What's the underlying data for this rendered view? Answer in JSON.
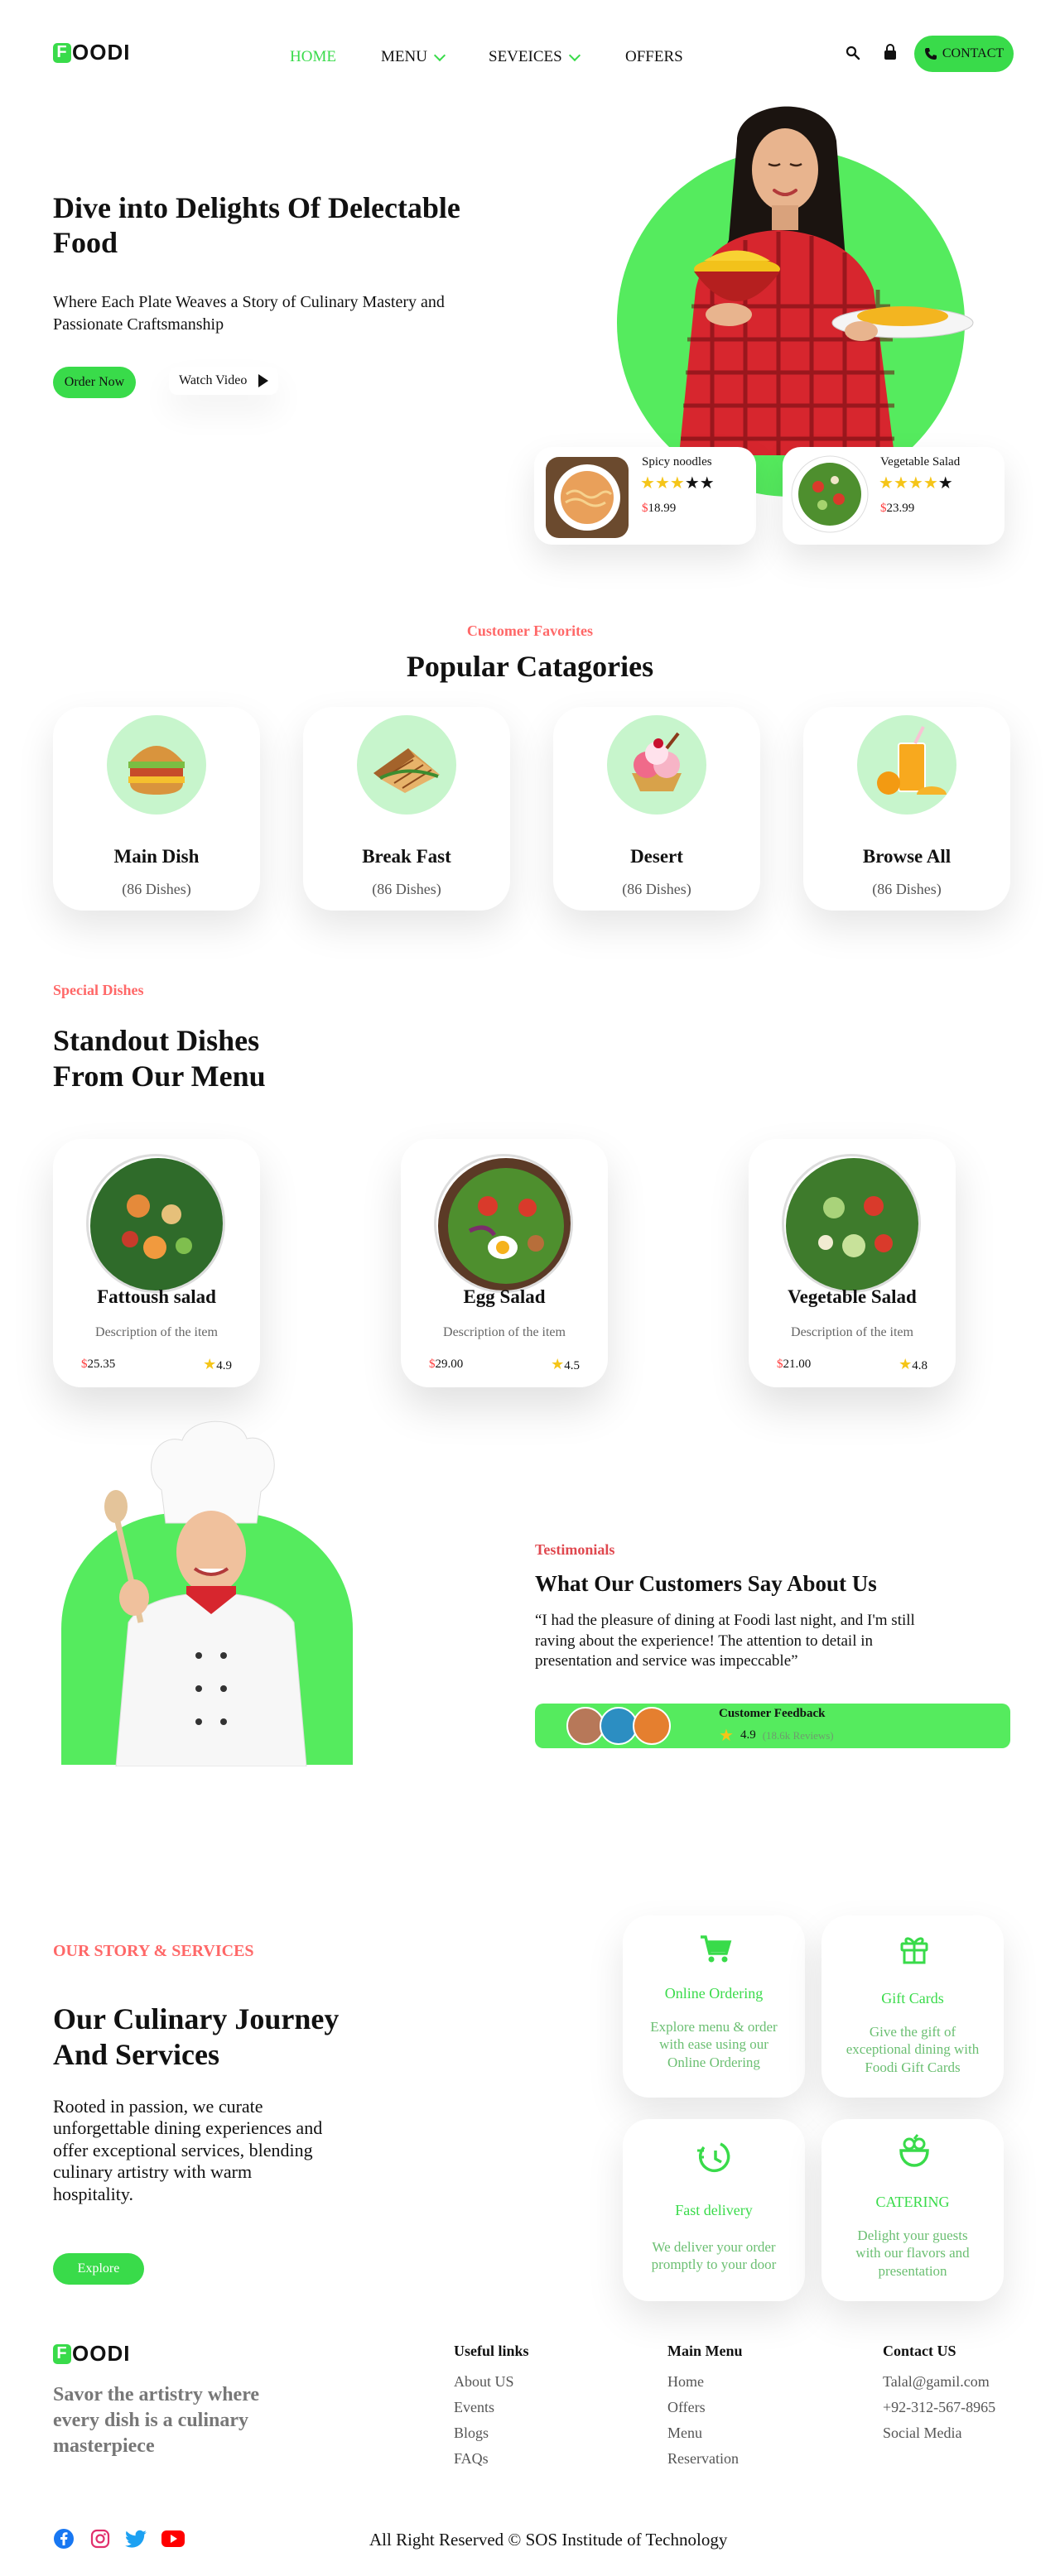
{
  "nav": {
    "logo_letter": "F",
    "logo_rest": "OODI",
    "items": [
      {
        "label": "HOME"
      },
      {
        "label": "MENU"
      },
      {
        "label": "SEVEICES"
      },
      {
        "label": "OFFERS"
      }
    ],
    "contact_label": "CONTACT"
  },
  "hero": {
    "title_line1": "Dive into Delights Of Delectable",
    "title_line2": "Food",
    "subtitle_line1": "Where Each Plate Weaves a Story of Culinary Mastery and",
    "subtitle_line2": "Passionate Craftsmanship",
    "order_label": "Order Now",
    "watch_label": "Watch Video",
    "cards": [
      {
        "name": "Spicy noodles",
        "rating": 3,
        "price_symbol": "$",
        "price": "18.99"
      },
      {
        "name": "Vegetable Salad",
        "rating": 4,
        "price_symbol": "$",
        "price": "23.99"
      }
    ]
  },
  "categories": {
    "eyebrow": "Customer Favorites",
    "heading": "Popular Catagories",
    "items": [
      {
        "title": "Main Dish",
        "count": "(86 Dishes)"
      },
      {
        "title": "Break Fast",
        "count": "(86 Dishes)"
      },
      {
        "title": "Desert",
        "count": "(86 Dishes)"
      },
      {
        "title": "Browse All",
        "count": "(86 Dishes)"
      }
    ]
  },
  "specials": {
    "eyebrow": "Special Dishes",
    "heading_line1": "Standout Dishes",
    "heading_line2": "From Our Menu",
    "items": [
      {
        "title": "Fattoush salad",
        "desc": "Description of the item",
        "price_symbol": "$",
        "price": "25.35",
        "rating": "4.9"
      },
      {
        "title": "Egg Salad",
        "desc": "Description of the item",
        "price_symbol": "$",
        "price": "29.00",
        "rating": "4.5"
      },
      {
        "title": "Vegetable Salad",
        "desc": "Description of the item",
        "price_symbol": "$",
        "price": "21.00",
        "rating": "4.8"
      }
    ]
  },
  "testimonials": {
    "eyebrow": "Testimonials",
    "heading": "What Our Customers Say About Us",
    "quote_line1": "“I had the pleasure of dining at Foodi last night, and I'm still",
    "quote_line2": "raving about the experience! The attention to detail in",
    "quote_line3": "presentation and service was impeccable”",
    "feedback_label": "Customer Feedback",
    "rating": "4.9",
    "reviews": "(18.6k Reviews)"
  },
  "services": {
    "eyebrow": "OUR STORY & SERVICES",
    "heading_line1": "Our Culinary Journey",
    "heading_line2": "And Services",
    "body_line1": "Rooted in passion, we curate",
    "body_line2": "unforgettable dining experiences and",
    "body_line3": "offer exceptional services, blending",
    "body_line4": "culinary artistry with warm",
    "body_line5": "hospitality.",
    "explore_label": "Explore",
    "cards": [
      {
        "title": "Online Ordering",
        "desc_line1": "Explore menu & order",
        "desc_line2": "with ease using our",
        "desc_line3": "Online Ordering",
        "icon": "cart-icon"
      },
      {
        "title": "Gift Cards",
        "desc_line1": "Give the gift of",
        "desc_line2": "exceptional dining with",
        "desc_line3": "Foodi Gift Cards",
        "icon": "gift-icon"
      },
      {
        "title": "Fast delivery",
        "desc_line1": "We deliver your order",
        "desc_line2": "promptly to your door",
        "desc_line3": "",
        "icon": "clock-delivery-icon"
      },
      {
        "title": "CATERING",
        "desc_line1": "Delight your guests",
        "desc_line2": "with our flavors and",
        "desc_line3": "presentation",
        "icon": "catering-icon"
      }
    ]
  },
  "footer": {
    "tagline_line1": "Savor the artistry where",
    "tagline_line2": "every dish is a culinary",
    "tagline_line3": "masterpiece",
    "useful_links": {
      "heading": "Useful links",
      "links": [
        "About US",
        "Events",
        "Blogs",
        "FAQs"
      ]
    },
    "main_menu": {
      "heading": "Main Menu",
      "links": [
        "Home",
        "Offers",
        "Menu",
        "Reservation"
      ]
    },
    "contact": {
      "heading": "Contact US",
      "links": [
        "Talal@gamil.com",
        "+92-312-567-8965",
        "Social Media"
      ]
    },
    "copyright": "All Right Reserved © SOS Institude of Technology",
    "social_icons": [
      "facebook-icon",
      "instagram-icon",
      "twitter-icon",
      "youtube-icon"
    ]
  },
  "colors": {
    "accent": "#39DB4A",
    "eyebrow": "#FF6868",
    "star": "#F5C518",
    "light_green": "#C7F5CC"
  }
}
